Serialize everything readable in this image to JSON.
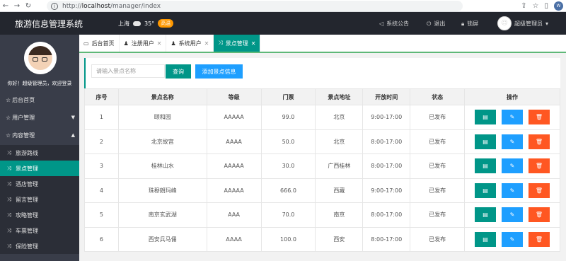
{
  "browser": {
    "url_proto": "http://",
    "url_host": "localhost",
    "url_path": "/manager/index"
  },
  "header": {
    "title": "旅游信息管理系统",
    "city": "上海",
    "temp": "35°",
    "aqi": "高温",
    "notice": "系统公告",
    "logout": "退出",
    "lock": "锁屏",
    "user": "超级管理员"
  },
  "sidebar": {
    "welcome": "你好！超级管理员，欢迎登录",
    "items": [
      {
        "label": "后台首页"
      },
      {
        "label": "用户管理"
      },
      {
        "label": "内容管理"
      }
    ],
    "sub_items": [
      {
        "label": "旅游路线"
      },
      {
        "label": "景点管理"
      },
      {
        "label": "酒店管理"
      },
      {
        "label": "留言管理"
      },
      {
        "label": "攻略管理"
      },
      {
        "label": "车票管理"
      },
      {
        "label": "保险管理"
      }
    ]
  },
  "tabs": [
    {
      "label": "后台首页"
    },
    {
      "label": "注册用户"
    },
    {
      "label": "系统用户"
    },
    {
      "label": "景点管理"
    }
  ],
  "search": {
    "placeholder": "请输入景点名称",
    "query_label": "查询",
    "add_label": "添加景点信息"
  },
  "table": {
    "headers": [
      "序号",
      "景点名称",
      "等级",
      "门票",
      "景点地址",
      "开放时间",
      "状态",
      "操作"
    ],
    "rows": [
      {
        "no": "1",
        "name": "颐和园",
        "level": "AAAAA",
        "price": "99.0",
        "addr": "北京",
        "hours": "9:00-17:00",
        "status": "已发布"
      },
      {
        "no": "2",
        "name": "北京故宫",
        "level": "AAAA",
        "price": "50.0",
        "addr": "北京",
        "hours": "8:00-17:00",
        "status": "已发布"
      },
      {
        "no": "3",
        "name": "桂林山水",
        "level": "AAAAA",
        "price": "30.0",
        "addr": "广西桂林",
        "hours": "8:00-17:00",
        "status": "已发布"
      },
      {
        "no": "4",
        "name": "珠穆朗玛峰",
        "level": "AAAAA",
        "price": "666.0",
        "addr": "西藏",
        "hours": "9:00-17:00",
        "status": "已发布"
      },
      {
        "no": "5",
        "name": "南京玄武湖",
        "level": "AAA",
        "price": "70.0",
        "addr": "南京",
        "hours": "8:00-17:00",
        "status": "已发布"
      },
      {
        "no": "6",
        "name": "西安兵马俑",
        "level": "AAAA",
        "price": "100.0",
        "addr": "西安",
        "hours": "8:00-17:00",
        "status": "已发布"
      }
    ]
  }
}
